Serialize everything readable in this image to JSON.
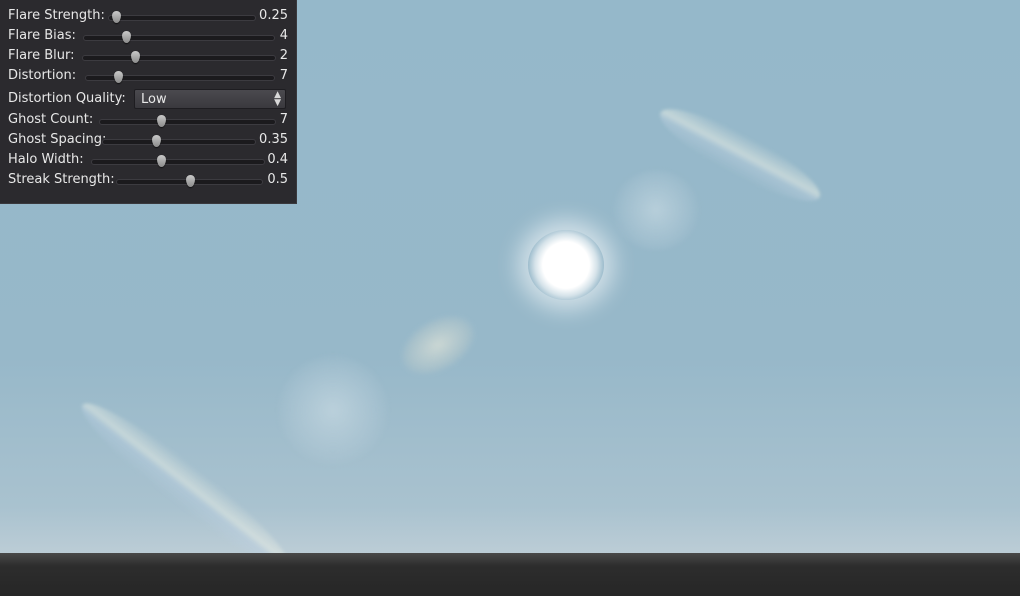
{
  "panel": {
    "flare_strength": {
      "label": "Flare Strength:",
      "value": "0.25",
      "level": 0.05
    },
    "flare_bias": {
      "label": "Flare Bias:",
      "value": "4",
      "level": 0.22
    },
    "flare_blur": {
      "label": "Flare Blur:",
      "value": "2",
      "level": 0.27
    },
    "distortion": {
      "label": "Distortion:",
      "value": "7",
      "level": 0.17
    },
    "distortion_quality": {
      "label": "Distortion Quality:",
      "selected": "Low"
    },
    "ghost_count": {
      "label": "Ghost Count:",
      "value": "7",
      "level": 0.35
    },
    "ghost_spacing": {
      "label": "Ghost Spacing:",
      "value": "0.35",
      "level": 0.35
    },
    "halo_width": {
      "label": "Halo Width:",
      "value": "0.4",
      "level": 0.4
    },
    "streak_strength": {
      "label": "Streak Strength:",
      "value": "0.5",
      "level": 0.5
    }
  },
  "colors": {
    "panel_bg": "#2b2a2e",
    "sky": "#95b8ca",
    "ground": "#2d2d2d"
  },
  "icons": {
    "select_arrows": "up-down-arrows-icon",
    "slider_thumb": "slider-thumb-icon"
  }
}
